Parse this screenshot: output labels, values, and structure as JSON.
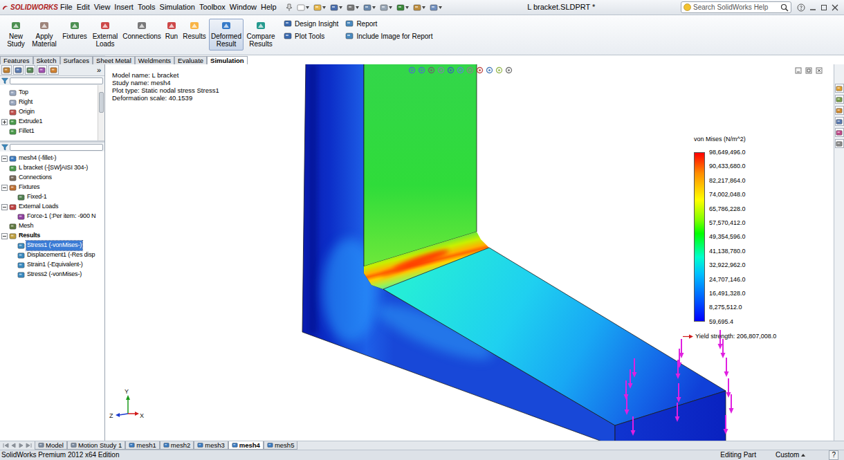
{
  "window": {
    "logo": "SOLIDWORKS",
    "title": "L bracket.SLDPRT *"
  },
  "menu": [
    "File",
    "Edit",
    "View",
    "Insert",
    "Tools",
    "Simulation",
    "Toolbox",
    "Window",
    "Help"
  ],
  "search": {
    "placeholder": "Search SolidWorks Help"
  },
  "ribbon": {
    "buttons": [
      {
        "label": "New Study",
        "selected": false
      },
      {
        "label": "Apply Material",
        "selected": false
      },
      {
        "label": "Fixtures",
        "selected": false
      },
      {
        "label": "External Loads",
        "selected": false
      },
      {
        "label": "Connections",
        "selected": false
      },
      {
        "label": "Run",
        "selected": false
      },
      {
        "label": "Results",
        "selected": false
      },
      {
        "label": "Deformed Result",
        "selected": true
      },
      {
        "label": "Compare Results",
        "selected": false
      }
    ],
    "small": [
      [
        "Design Insight",
        "Plot Tools"
      ],
      [
        "Report",
        "Include Image for Report"
      ]
    ]
  },
  "tabs": [
    {
      "label": "Features",
      "selected": false
    },
    {
      "label": "Sketch",
      "selected": false
    },
    {
      "label": "Surfaces",
      "selected": false
    },
    {
      "label": "Sheet Metal",
      "selected": false
    },
    {
      "label": "Weldments",
      "selected": false
    },
    {
      "label": "Evaluate",
      "selected": false
    },
    {
      "label": "Simulation",
      "selected": true
    }
  ],
  "feature_tree": {
    "more": "»",
    "items": [
      {
        "label": "Top",
        "kind": "plane",
        "depth": 1,
        "has_children": false,
        "expanded": false,
        "selected": false,
        "bold": false
      },
      {
        "label": "Right",
        "kind": "plane",
        "depth": 1,
        "has_children": false,
        "expanded": false,
        "selected": false,
        "bold": false
      },
      {
        "label": "Origin",
        "kind": "origin",
        "depth": 1,
        "has_children": false,
        "expanded": false,
        "selected": false,
        "bold": false
      },
      {
        "label": "Extrude1",
        "kind": "extrude",
        "depth": 1,
        "has_children": true,
        "expanded": false,
        "selected": false,
        "bold": false
      },
      {
        "label": "Fillet1",
        "kind": "fillet",
        "depth": 1,
        "has_children": false,
        "expanded": false,
        "selected": false,
        "bold": false
      }
    ]
  },
  "study_tree": [
    {
      "label": "mesh4 (-fillet-)",
      "kind": "study",
      "depth": 0,
      "has_children": true,
      "expanded": true,
      "selected": false,
      "bold": false
    },
    {
      "label": "L bracket (-[SW]AISI 304-)",
      "kind": "part",
      "depth": 1,
      "has_children": false,
      "expanded": false,
      "selected": false,
      "bold": false
    },
    {
      "label": "Connections",
      "kind": "connections",
      "depth": 1,
      "has_children": false,
      "expanded": false,
      "selected": false,
      "bold": false
    },
    {
      "label": "Fixtures",
      "kind": "fixtures",
      "depth": 1,
      "has_children": true,
      "expanded": true,
      "selected": false,
      "bold": false
    },
    {
      "label": "Fixed-1",
      "kind": "fixture",
      "depth": 2,
      "has_children": false,
      "expanded": false,
      "selected": false,
      "bold": false
    },
    {
      "label": "External Loads",
      "kind": "loads",
      "depth": 1,
      "has_children": true,
      "expanded": true,
      "selected": false,
      "bold": false
    },
    {
      "label": "Force-1 (:Per item: -900 N",
      "kind": "force",
      "depth": 2,
      "has_children": false,
      "expanded": false,
      "selected": false,
      "bold": false
    },
    {
      "label": "Mesh",
      "kind": "mesh",
      "depth": 1,
      "has_children": false,
      "expanded": false,
      "selected": false,
      "bold": false
    },
    {
      "label": "Results",
      "kind": "results",
      "depth": 1,
      "has_children": true,
      "expanded": true,
      "selected": false,
      "bold": true
    },
    {
      "label": "Stress1 (-vonMises-)",
      "kind": "plot",
      "depth": 2,
      "has_children": false,
      "expanded": false,
      "selected": true,
      "bold": false
    },
    {
      "label": "Displacement1 (-Res disp",
      "kind": "plot",
      "depth": 2,
      "has_children": false,
      "expanded": false,
      "selected": false,
      "bold": false
    },
    {
      "label": "Strain1 (-Equivalent-)",
      "kind": "plot",
      "depth": 2,
      "has_children": false,
      "expanded": false,
      "selected": false,
      "bold": false
    },
    {
      "label": "Stress2 (-vonMises-)",
      "kind": "plot",
      "depth": 2,
      "has_children": false,
      "expanded": false,
      "selected": false,
      "bold": false
    }
  ],
  "graphics": {
    "info": [
      "Model name: L bracket",
      "Study name: mesh4",
      "Plot type: Static nodal stress Stress1",
      "Deformation scale: 40.1539"
    ],
    "legend": {
      "title": "von Mises (N/m^2)",
      "ticks": [
        "98,649,496.0",
        "90,433,680.0",
        "82,217,864.0",
        "74,002,048.0",
        "65,786,228.0",
        "57,570,412.0",
        "49,354,596.0",
        "41,138,780.0",
        "32,922,962.0",
        "24,707,146.0",
        "16,491,328.0",
        "8,275,512.0",
        "59,695.4"
      ],
      "yield": "Yield strength: 206,807,008.0"
    },
    "triad": {
      "x": "X",
      "y": "Y",
      "z": "Z"
    }
  },
  "bottom_tabs": [
    {
      "label": "Model",
      "selected": false
    },
    {
      "label": "Motion Study 1",
      "selected": false
    },
    {
      "label": "mesh1",
      "selected": false
    },
    {
      "label": "mesh2",
      "selected": false
    },
    {
      "label": "mesh3",
      "selected": false
    },
    {
      "label": "mesh4",
      "selected": true
    },
    {
      "label": "mesh5",
      "selected": false
    }
  ],
  "status_bar": {
    "edition": "SolidWorks Premium 2012 x64 Edition",
    "mode": "Editing Part",
    "units": "Custom",
    "help": "?"
  }
}
